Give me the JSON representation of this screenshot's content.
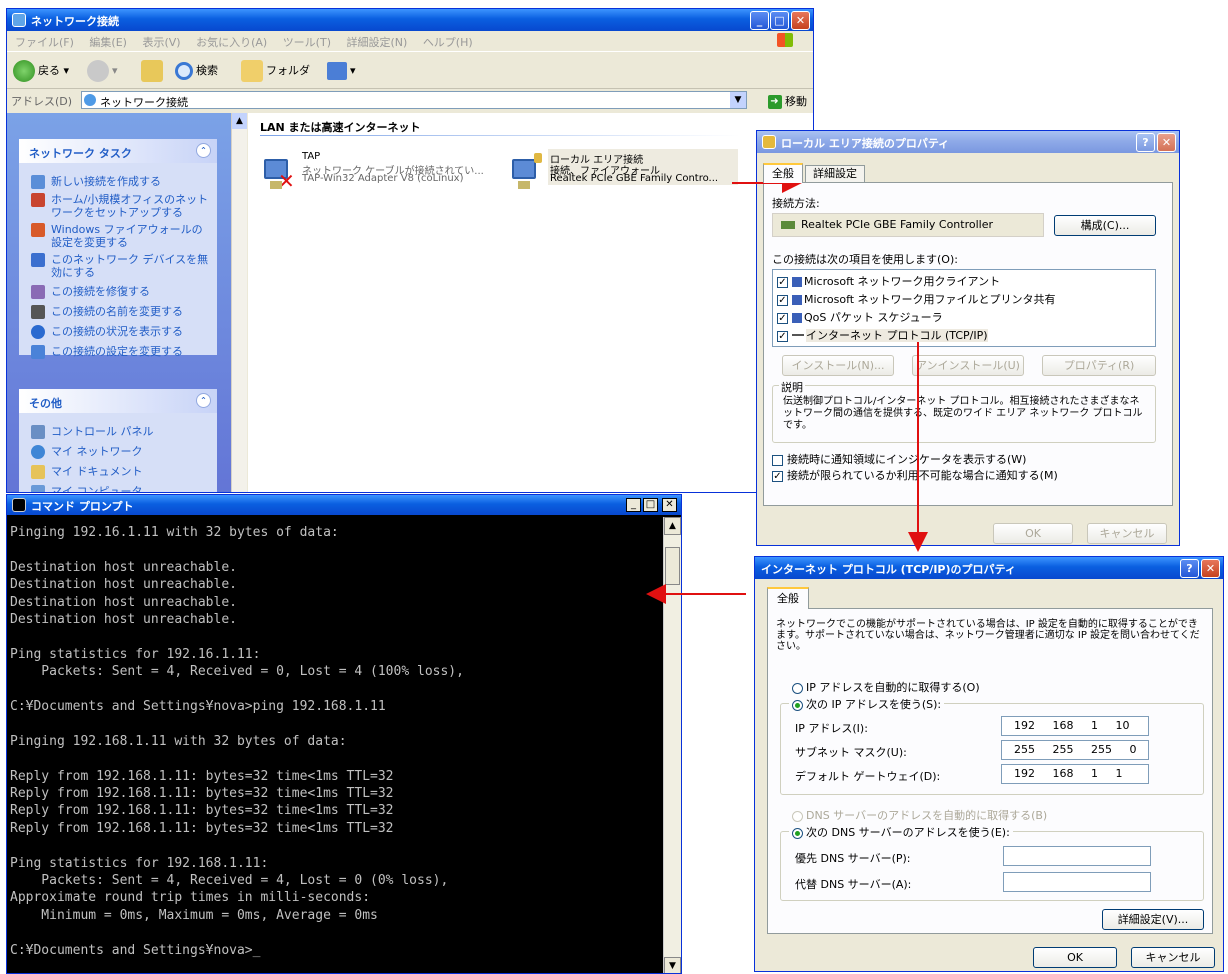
{
  "net_window": {
    "title": "ネットワーク接続",
    "menu": [
      "ファイル(F)",
      "編集(E)",
      "表示(V)",
      "お気に入り(A)",
      "ツール(T)",
      "詳細設定(N)",
      "ヘルプ(H)"
    ],
    "toolbar": {
      "back": "戻る",
      "search": "検索",
      "folders": "フォルダ"
    },
    "address_label": "アドレス(D)",
    "address_value": "ネットワーク接続",
    "go_label": "移動",
    "task_panel": {
      "title": "ネットワーク タスク",
      "items": [
        "新しい接続を作成する",
        "ホーム/小規模オフィスのネットワークをセットアップする",
        "Windows ファイアウォールの設定を変更する",
        "このネットワーク デバイスを無効にする",
        "この接続を修復する",
        "この接続の名前を変更する",
        "この接続の状況を表示する",
        "この接続の設定を変更する"
      ]
    },
    "other_panel": {
      "title": "その他",
      "items": [
        "コントロール パネル",
        "マイ ネットワーク",
        "マイ ドキュメント",
        "マイ コンピュータ"
      ]
    },
    "section_heading": "LAN または高速インターネット",
    "connections": [
      {
        "name": "TAP",
        "status": "ネットワーク ケーブルが接続されてい...",
        "device": "TAP-Win32 Adapter V8 (coLinux)"
      },
      {
        "name": "ローカル エリア接続",
        "status": "接続、ファイアウォール",
        "device": "Realtek PCIe GBE Family Contro..."
      }
    ]
  },
  "props_window": {
    "title": "ローカル エリア接続のプロパティ",
    "tabs": [
      "全般",
      "詳細設定"
    ],
    "connect_using_label": "接続方法:",
    "adapter": "Realtek PCIe GBE Family Controller",
    "configure_button": "構成(C)...",
    "items_label": "この接続は次の項目を使用します(O):",
    "items": [
      "Microsoft ネットワーク用クライアント",
      "Microsoft ネットワーク用ファイルとプリンタ共有",
      "QoS パケット スケジューラ",
      "インターネット プロトコル (TCP/IP)"
    ],
    "install_button": "インストール(N)...",
    "uninstall_button": "アンインストール(U)",
    "properties_button": "プロパティ(R)",
    "description_label": "説明",
    "description_text": "伝送制御プロトコル/インターネット プロトコル。相互接続されたさまざまなネットワーク間の通信を提供する、既定のワイド エリア ネットワーク プロトコルです。",
    "check_show_icon": "接続時に通知領域にインジケータを表示する(W)",
    "check_notify": "接続が限られているか利用不可能な場合に通知する(M)",
    "ok_button": "OK",
    "cancel_button": "キャンセル"
  },
  "tcpip_window": {
    "title": "インターネット プロトコル (TCP/IP)のプロパティ",
    "tab": "全般",
    "intro": "ネットワークでこの機能がサポートされている場合は、IP 設定を自動的に取得することができます。サポートされていない場合は、ネットワーク管理者に適切な IP 設定を問い合わせてください。",
    "radio_auto_ip": "IP アドレスを自動的に取得する(O)",
    "radio_manual_ip": "次の IP アドレスを使う(S):",
    "ip_label": "IP アドレス(I):",
    "ip_value": "192 168 1 10",
    "subnet_label": "サブネット マスク(U):",
    "subnet_value": "255 255 255 0",
    "gateway_label": "デフォルト ゲートウェイ(D):",
    "gateway_value": "192 168 1 1",
    "radio_auto_dns": "DNS サーバーのアドレスを自動的に取得する(B)",
    "radio_manual_dns": "次の DNS サーバーのアドレスを使う(E):",
    "dns1_label": "優先 DNS サーバー(P):",
    "dns2_label": "代替 DNS サーバー(A):",
    "advanced_button": "詳細設定(V)...",
    "ok_button": "OK",
    "cancel_button": "キャンセル"
  },
  "cmd_window": {
    "title": "コマンド プロンプト",
    "lines": [
      "Pinging 192.16.1.11 with 32 bytes of data:",
      "",
      "Destination host unreachable.",
      "Destination host unreachable.",
      "Destination host unreachable.",
      "Destination host unreachable.",
      "",
      "Ping statistics for 192.16.1.11:",
      "    Packets: Sent = 4, Received = 0, Lost = 4 (100% loss),",
      "",
      "C:¥Documents and Settings¥nova>ping 192.168.1.11",
      "",
      "Pinging 192.168.1.11 with 32 bytes of data:",
      "",
      "Reply from 192.168.1.11: bytes=32 time<1ms TTL=32",
      "Reply from 192.168.1.11: bytes=32 time<1ms TTL=32",
      "Reply from 192.168.1.11: bytes=32 time<1ms TTL=32",
      "Reply from 192.168.1.11: bytes=32 time<1ms TTL=32",
      "",
      "Ping statistics for 192.168.1.11:",
      "    Packets: Sent = 4, Received = 4, Lost = 0 (0% loss),",
      "Approximate round trip times in milli-seconds:",
      "    Minimum = 0ms, Maximum = 0ms, Average = 0ms",
      "",
      "C:¥Documents and Settings¥nova>_"
    ]
  },
  "colors": {
    "arrow": "#e01010",
    "xp_blue": "#0a5fe0",
    "console_bg": "#000000"
  }
}
